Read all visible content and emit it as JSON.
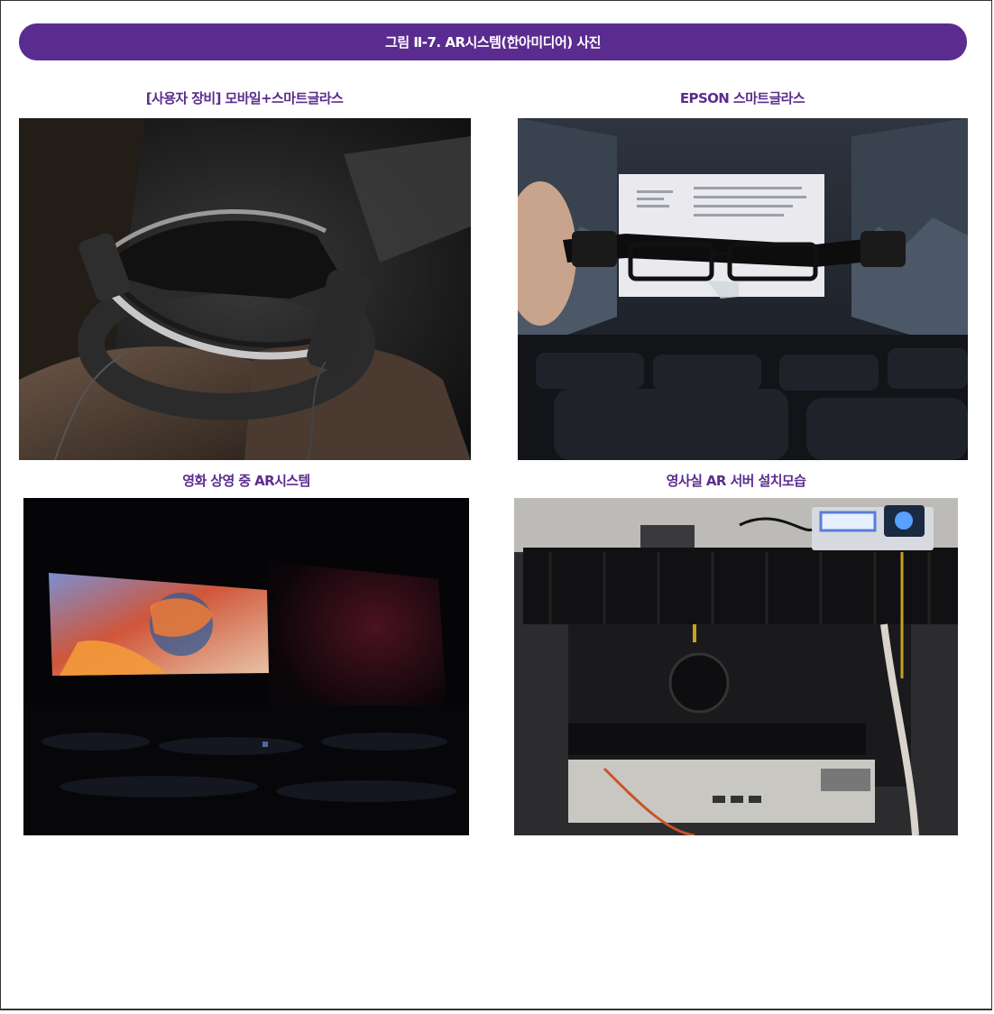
{
  "figure_title": "그림 Ⅱ-7. AR시스템(한아미디어) 사진",
  "photos": [
    {
      "caption": "[사용자 장비] 모바일+스마트글라스"
    },
    {
      "caption": "EPSON 스마트글라스"
    },
    {
      "caption": "영화 상영 중 AR시스템"
    },
    {
      "caption": "영사실 AR 서버 설치모습"
    }
  ]
}
